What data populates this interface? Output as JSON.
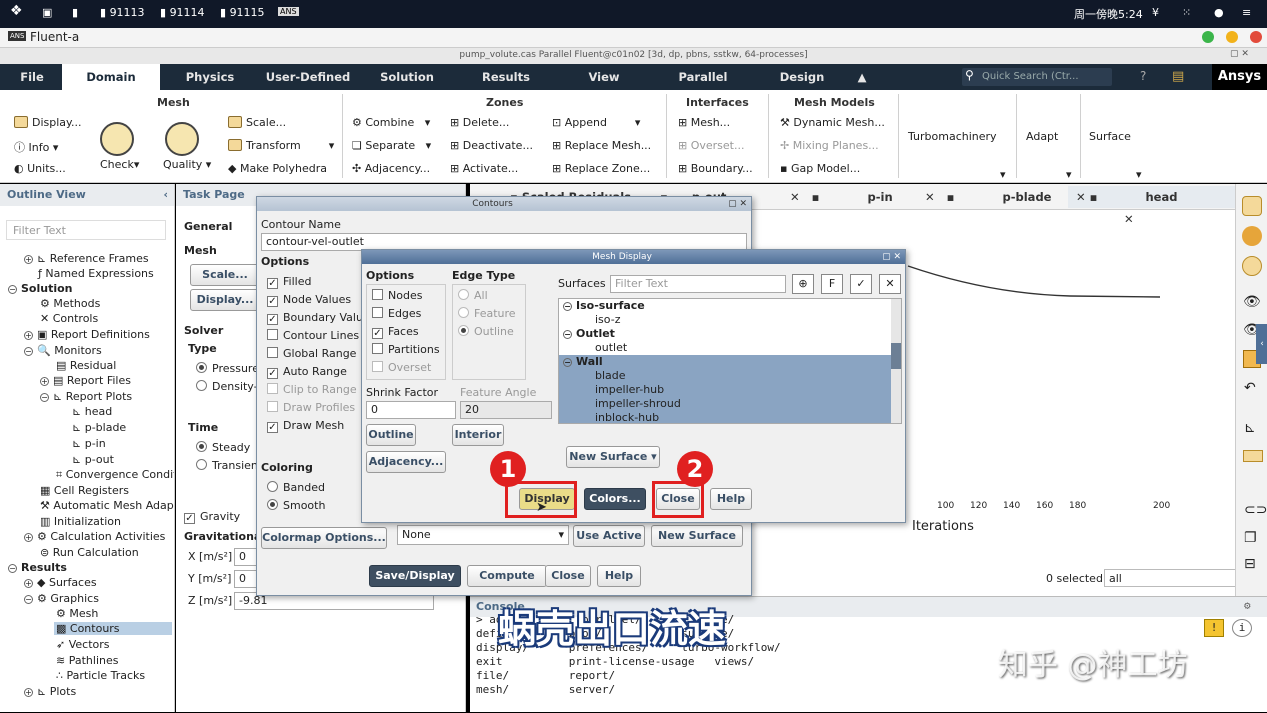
{
  "taskbar": {
    "items": [
      "91113",
      "91114",
      "91115"
    ],
    "clock": "周一傍晚5:24"
  },
  "app": {
    "title": "Fluent-a"
  },
  "window": {
    "title": "pump_volute.cas Parallel Fluent@c01n02  [3d, dp, pbns, sstkw, 64-processes]"
  },
  "tabs": [
    "File",
    "Domain",
    "Physics",
    "User-Defined",
    "Solution",
    "Results",
    "View",
    "Parallel",
    "Design"
  ],
  "quick_search": {
    "placeholder": "Quick Search (Ctr..."
  },
  "brand": "Ansys",
  "ribbon": {
    "mesh": {
      "title": "Mesh",
      "display": "Display...",
      "info": "Info",
      "units": "Units...",
      "check": "Check",
      "quality": "Quality",
      "scale": "Scale...",
      "transform": "Transform",
      "make_polyhedra": "Make Polyhedra"
    },
    "zones": {
      "title": "Zones",
      "combine": "Combine",
      "separate": "Separate",
      "adjacency": "Adjacency...",
      "delete": "Delete...",
      "deactivate": "Deactivate...",
      "activate": "Activate...",
      "append": "Append",
      "replace_mesh": "Replace Mesh...",
      "replace_zone": "Replace Zone..."
    },
    "interfaces": {
      "title": "Interfaces",
      "mesh": "Mesh...",
      "overset": "Overset...",
      "boundary": "Boundary..."
    },
    "mesh_models": {
      "title": "Mesh Models",
      "dynamic_mesh": "Dynamic Mesh...",
      "mixing_planes": "Mixing Planes...",
      "gap_model": "Gap Model..."
    },
    "turbo": "Turbomachinery",
    "adapt": "Adapt",
    "surface": "Surface"
  },
  "outline": {
    "title": "Outline View",
    "filter": "Filter Text",
    "items": [
      "Reference Frames",
      "Named Expressions",
      "Solution",
      "Methods",
      "Controls",
      "Report Definitions",
      "Monitors",
      "Residual",
      "Report Files",
      "Report Plots",
      "head",
      "p-blade",
      "p-in",
      "p-out",
      "Convergence Conditions",
      "Cell Registers",
      "Automatic Mesh Adaption",
      "Initialization",
      "Calculation Activities",
      "Run Calculation",
      "Results",
      "Surfaces",
      "Graphics",
      "Mesh",
      "Contours",
      "Vectors",
      "Pathlines",
      "Particle Tracks",
      "Plots"
    ]
  },
  "taskpage": {
    "title": "Task Page",
    "general": "General",
    "mesh_label": "Mesh",
    "scale_btn": "Scale...",
    "display_btn": "Display...",
    "solver": "Solver",
    "type": "Type",
    "pressure": "Pressure",
    "density": "Density-",
    "time": "Time",
    "steady": "Steady",
    "transient": "Transien",
    "gravity": "Gravity",
    "gravitational": "Gravitational",
    "x": "X [m/s²]",
    "x_val": "0",
    "y": "Y [m/s²]",
    "y_val": "0",
    "z": "Z [m/s²]",
    "z_val": "-9.81"
  },
  "graphics_tabs": [
    "Scaled Residuals",
    "p-out",
    "p-in",
    "p-blade",
    "head"
  ],
  "plot": {
    "x_ticks": [
      "100",
      "120",
      "140",
      "160",
      "180",
      "200"
    ],
    "xlabel": "Iterations",
    "selected": "0 selected",
    "select_value": "all"
  },
  "contours": {
    "title": "Contours",
    "name_label": "Contour Name",
    "name_value": "contour-vel-outlet",
    "options": "Options",
    "filled": "Filled",
    "node_values": "Node Values",
    "boundary_values": "Boundary Valu",
    "contour_lines": "Contour Lines",
    "global_range": "Global Range",
    "auto_range": "Auto Range",
    "clip_to_range": "Clip to Range",
    "draw_profiles": "Draw Profiles",
    "draw_mesh": "Draw Mesh",
    "coloring": "Coloring",
    "banded": "Banded",
    "smooth": "Smooth",
    "colormap": "Colormap Options...",
    "none": "None",
    "use_active": "Use Active",
    "new_surface": "New Surface",
    "save_display": "Save/Display",
    "compute": "Compute",
    "close": "Close",
    "help": "Help"
  },
  "mesh_display": {
    "title": "Mesh Display",
    "options": "Options",
    "nodes": "Nodes",
    "edges": "Edges",
    "faces": "Faces",
    "partitions": "Partitions",
    "overset": "Overset",
    "edge_type": "Edge Type",
    "all": "All",
    "feature": "Feature",
    "outline": "Outline",
    "surfaces": "Surfaces",
    "filter": "Filter Text",
    "shrink_factor": "Shrink Factor",
    "shrink_value": "0",
    "feature_angle": "Feature Angle",
    "feature_value": "20",
    "outline_btn": "Outline",
    "interior_btn": "Interior",
    "adjacency_btn": "Adjacency...",
    "new_surface": "New Surface",
    "list": [
      {
        "t": "Iso-surface",
        "h": 1
      },
      {
        "t": "iso-z"
      },
      {
        "t": "Outlet",
        "h": 1
      },
      {
        "t": "outlet"
      },
      {
        "t": "Wall",
        "h": 1,
        "s": 1
      },
      {
        "t": "blade",
        "s": 1
      },
      {
        "t": "impeller-hub",
        "s": 1
      },
      {
        "t": "impeller-shroud",
        "s": 1
      },
      {
        "t": "inblock-hub",
        "s": 1
      }
    ],
    "display_btn": "Display",
    "colors_btn": "Colors...",
    "close_btn": "Close",
    "help_btn": "Help"
  },
  "annotations": {
    "one": "1",
    "two": "2"
  },
  "console": {
    "title": "Console",
    "lines": [
      "> adapt/        parallel/        solve/",
      "define/       plot/            surface/",
      "display/      preferences/     turbo-workflow/",
      "exit          print-license-usage   views/",
      "file/         report/",
      "mesh/         server/"
    ]
  },
  "subtitle": "蜗壳出口流速",
  "watermark": "知乎 @神工坊",
  "colors": {
    "accent": "#1c2b3a",
    "annotation_red": "#e02020"
  }
}
